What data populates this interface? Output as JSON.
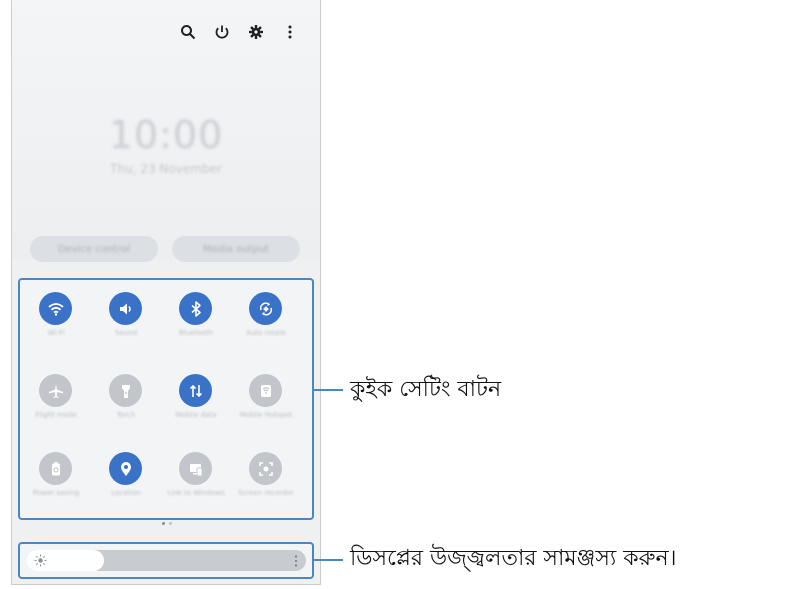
{
  "panel": {
    "clock": "10:00",
    "date": "Thu, 23 November",
    "device_control_label": "Device control",
    "media_output_label": "Media output",
    "top_icons": [
      "search-icon",
      "power-icon",
      "gear-icon",
      "more-vertical-icon"
    ]
  },
  "quick_settings": [
    {
      "icon": "wifi-icon",
      "label": "Wi-Fi",
      "active": true
    },
    {
      "icon": "sound-icon",
      "label": "Sound",
      "active": true
    },
    {
      "icon": "bluetooth-icon",
      "label": "Bluetooth",
      "active": true
    },
    {
      "icon": "auto-rotate-icon",
      "label": "Auto rotate",
      "active": true
    },
    {
      "icon": "airplane-icon",
      "label": "Flight mode",
      "active": false
    },
    {
      "icon": "flashlight-icon",
      "label": "Torch",
      "active": false
    },
    {
      "icon": "mobile-data-icon",
      "label": "Mobile data",
      "active": true
    },
    {
      "icon": "mobile-hotspot-icon",
      "label": "Mobile Hotspot",
      "active": false
    },
    {
      "icon": "power-saving-icon",
      "label": "Power saving",
      "active": false
    },
    {
      "icon": "location-icon",
      "label": "Location",
      "active": true
    },
    {
      "icon": "link-to-windows-icon",
      "label": "Link to Windows",
      "active": false
    },
    {
      "icon": "screen-recorder-icon",
      "label": "Screen recorder",
      "active": false
    }
  ],
  "page_dots": {
    "count": 2,
    "current": 1
  },
  "brightness": {
    "level": 0.28
  },
  "callouts": {
    "quick_settings": "কুইক সেটিং বাটন",
    "brightness": "ডিসপ্লের উজ্জ্বলতার সামঞ্জস্য করুন।"
  },
  "colors": {
    "accent": "#3a72c8",
    "outline": "#4a86c5",
    "inactive": "#c2c5ca"
  }
}
